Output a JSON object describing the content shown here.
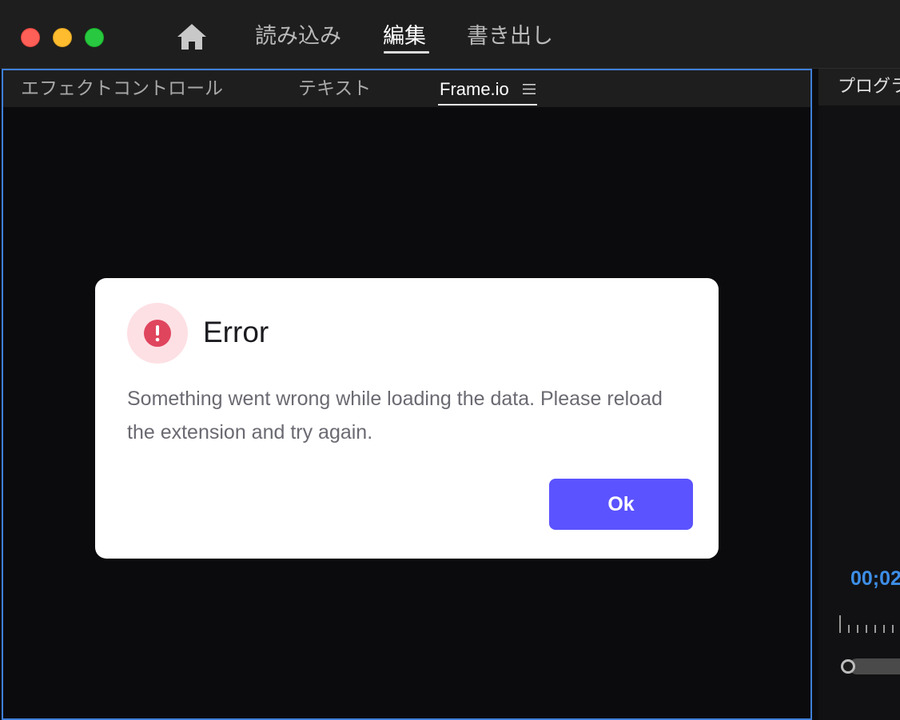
{
  "titlebar": {
    "nav": {
      "import": "読み込み",
      "edit": "編集",
      "export": "書き出し"
    },
    "active_nav": "edit"
  },
  "left_panel": {
    "tabs": [
      {
        "label": "エフェクトコントロール"
      },
      {
        "label": "テキスト"
      },
      {
        "label": "Frame.io",
        "active": true
      }
    ]
  },
  "right_panel": {
    "title": "プログラ",
    "timecode": "00;02"
  },
  "dialog": {
    "title": "Error",
    "message": "Something went wrong while loading the data. Please reload the extension and try again.",
    "ok_label": "Ok"
  },
  "colors": {
    "accent_button": "#5b53ff",
    "error_red": "#e0455e",
    "panel_focus_border": "#3f7fd9",
    "timecode_blue": "#3d8ee6"
  }
}
